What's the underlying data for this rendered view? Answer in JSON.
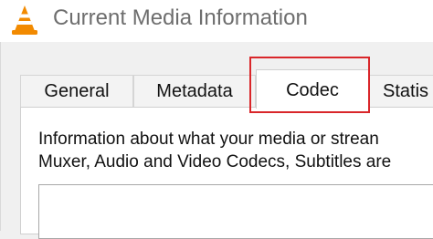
{
  "window": {
    "title": "Current Media Information",
    "icon": "vlc-cone-icon"
  },
  "tabs": [
    {
      "label": "General",
      "selected": false
    },
    {
      "label": "Metadata",
      "selected": false
    },
    {
      "label": "Codec",
      "selected": true
    },
    {
      "label": "Statis",
      "selected": false
    }
  ],
  "codec_page": {
    "info_line1": "Information about what your media or strean",
    "info_line2": "Muxer, Audio and Video Codecs, Subtitles are"
  },
  "colors": {
    "highlight": "#d9262a",
    "vlc_orange": "#f28a00"
  }
}
